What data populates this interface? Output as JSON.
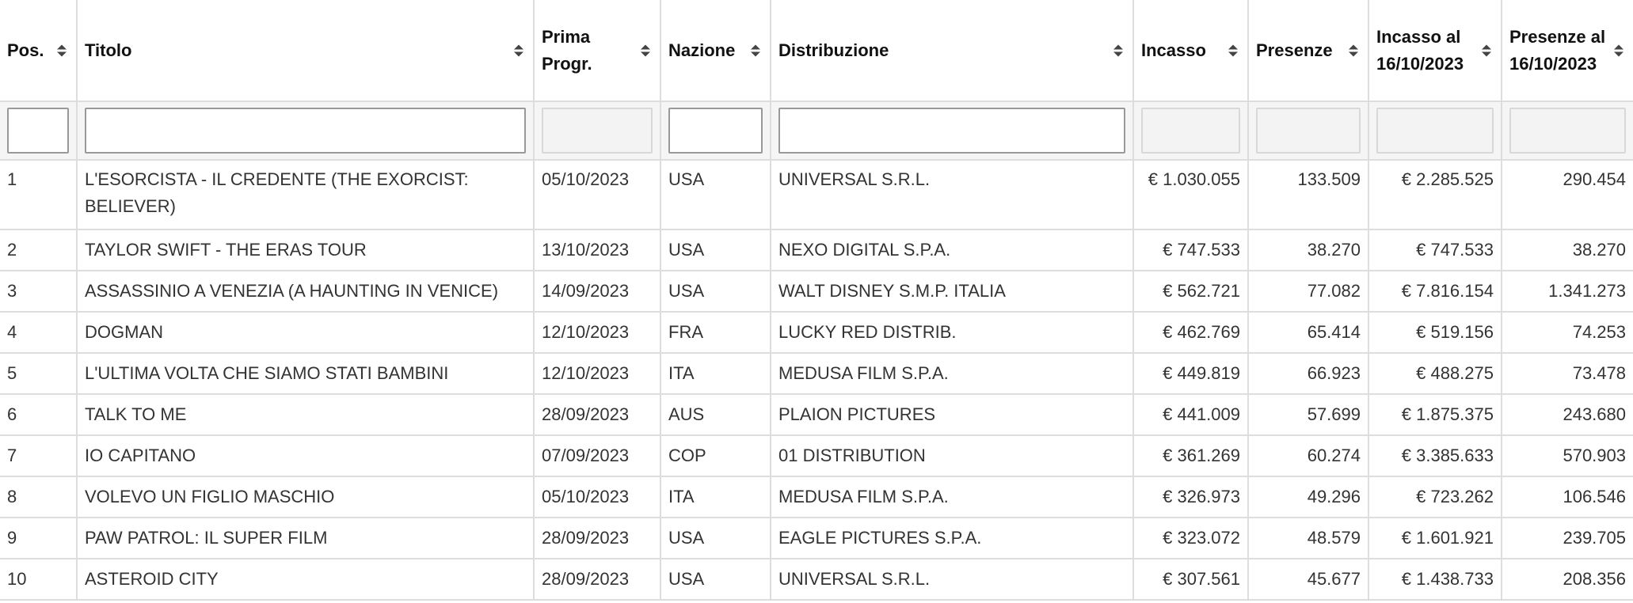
{
  "columns": [
    {
      "label": "Pos."
    },
    {
      "label": "Titolo"
    },
    {
      "label": "Prima Progr."
    },
    {
      "label": "Nazione"
    },
    {
      "label": "Distribuzione"
    },
    {
      "label": "Incasso"
    },
    {
      "label": "Presenze"
    },
    {
      "label": "Incasso al 16/10/2023"
    },
    {
      "label": "Presenze al 16/10/2023"
    }
  ],
  "filters": {
    "pos": "",
    "titolo": "",
    "nazione": "",
    "distribuzione": ""
  },
  "rows": [
    {
      "pos": "1",
      "titolo": "L'ESORCISTA - IL CREDENTE (THE EXORCIST: BELIEVER)",
      "prima": "05/10/2023",
      "nazione": "USA",
      "distribuzione": "UNIVERSAL S.R.L.",
      "incasso": "€ 1.030.055",
      "presenze": "133.509",
      "incasso_tot": "€ 2.285.525",
      "presenze_tot": "290.454"
    },
    {
      "pos": "2",
      "titolo": "TAYLOR SWIFT - THE ERAS TOUR",
      "prima": "13/10/2023",
      "nazione": "USA",
      "distribuzione": "NEXO DIGITAL S.P.A.",
      "incasso": "€ 747.533",
      "presenze": "38.270",
      "incasso_tot": "€ 747.533",
      "presenze_tot": "38.270"
    },
    {
      "pos": "3",
      "titolo": "ASSASSINIO A VENEZIA (A HAUNTING IN VENICE)",
      "prima": "14/09/2023",
      "nazione": "USA",
      "distribuzione": "WALT DISNEY S.M.P. ITALIA",
      "incasso": "€ 562.721",
      "presenze": "77.082",
      "incasso_tot": "€ 7.816.154",
      "presenze_tot": "1.341.273"
    },
    {
      "pos": "4",
      "titolo": "DOGMAN",
      "prima": "12/10/2023",
      "nazione": "FRA",
      "distribuzione": "LUCKY RED DISTRIB.",
      "incasso": "€ 462.769",
      "presenze": "65.414",
      "incasso_tot": "€ 519.156",
      "presenze_tot": "74.253"
    },
    {
      "pos": "5",
      "titolo": "L'ULTIMA VOLTA CHE SIAMO STATI BAMBINI",
      "prima": "12/10/2023",
      "nazione": "ITA",
      "distribuzione": "MEDUSA FILM S.P.A.",
      "incasso": "€ 449.819",
      "presenze": "66.923",
      "incasso_tot": "€ 488.275",
      "presenze_tot": "73.478"
    },
    {
      "pos": "6",
      "titolo": "TALK TO ME",
      "prima": "28/09/2023",
      "nazione": "AUS",
      "distribuzione": "PLAION PICTURES",
      "incasso": "€ 441.009",
      "presenze": "57.699",
      "incasso_tot": "€ 1.875.375",
      "presenze_tot": "243.680"
    },
    {
      "pos": "7",
      "titolo": "IO CAPITANO",
      "prima": "07/09/2023",
      "nazione": "COP",
      "distribuzione": "01 DISTRIBUTION",
      "incasso": "€ 361.269",
      "presenze": "60.274",
      "incasso_tot": "€ 3.385.633",
      "presenze_tot": "570.903"
    },
    {
      "pos": "8",
      "titolo": "VOLEVO UN FIGLIO MASCHIO",
      "prima": "05/10/2023",
      "nazione": "ITA",
      "distribuzione": "MEDUSA FILM S.P.A.",
      "incasso": "€ 326.973",
      "presenze": "49.296",
      "incasso_tot": "€ 723.262",
      "presenze_tot": "106.546"
    },
    {
      "pos": "9",
      "titolo": "PAW PATROL: IL SUPER FILM",
      "prima": "28/09/2023",
      "nazione": "USA",
      "distribuzione": "EAGLE PICTURES S.P.A.",
      "incasso": "€ 323.072",
      "presenze": "48.579",
      "incasso_tot": "€ 1.601.921",
      "presenze_tot": "239.705"
    },
    {
      "pos": "10",
      "titolo": "ASTEROID CITY",
      "prima": "28/09/2023",
      "nazione": "USA",
      "distribuzione": "UNIVERSAL S.R.L.",
      "incasso": "€ 307.561",
      "presenze": "45.677",
      "incasso_tot": "€ 1.438.733",
      "presenze_tot": "208.356"
    }
  ]
}
